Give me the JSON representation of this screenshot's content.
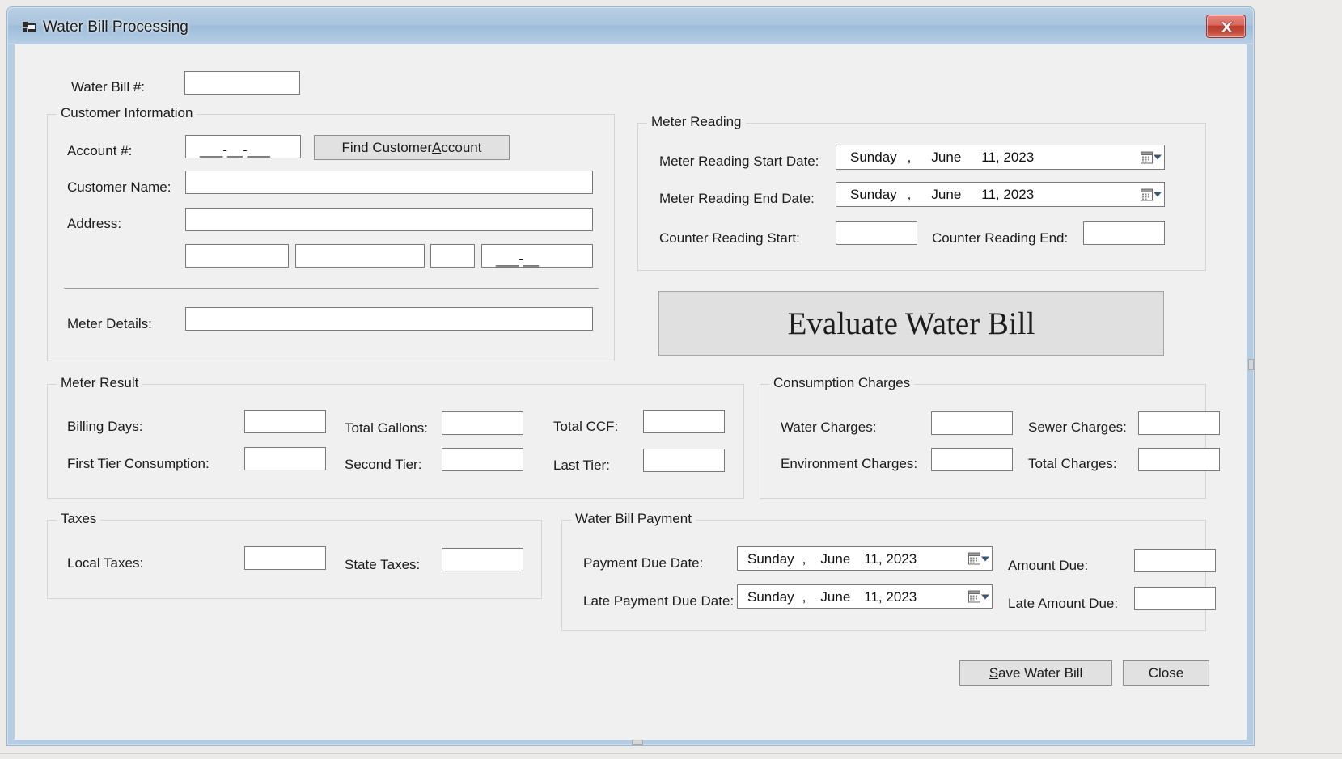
{
  "window": {
    "title": "Water Bill Processing",
    "icon": "application-form-icon",
    "close_label": "✕",
    "titlebar_color": "#a9c4dd",
    "close_color": "#ba3b2f",
    "form_background": "#f0f0f0"
  },
  "top": {
    "water_bill_label": "Water Bill #:",
    "water_bill_value": ""
  },
  "customer_information": {
    "title": "Customer Information",
    "account_label": "Account #:",
    "account_mask": "___-__-___",
    "find_button": {
      "prefix": "Find Customer ",
      "accel": "A",
      "suffix": "ccount",
      "full": "Find Customer Account"
    },
    "customer_name_label": "Customer Name:",
    "customer_name_value": "",
    "address_label": "Address:",
    "address_value": "",
    "city_value": "",
    "state_value": "",
    "zip_short_value": "",
    "zip_mask": "___-__",
    "meter_details_label": "Meter Details:",
    "meter_details_value": ""
  },
  "meter_reading": {
    "title": "Meter Reading",
    "start_date_label": "Meter Reading Start Date:",
    "start_date": {
      "day": "Sunday",
      "comma": ",",
      "month": "June",
      "date": "11, 2023"
    },
    "end_date_label": "Meter Reading End Date:",
    "end_date": {
      "day": "Sunday",
      "comma": ",",
      "month": "June",
      "date": "11, 2023"
    },
    "counter_start_label": "Counter Reading Start:",
    "counter_start_value": "",
    "counter_end_label": "Counter Reading End:",
    "counter_end_value": ""
  },
  "evaluate_button": {
    "label": "Evaluate Water Bill"
  },
  "meter_result": {
    "title": "Meter Result",
    "fields": [
      {
        "label": "Billing Days:",
        "value": ""
      },
      {
        "label": "Total Gallons:",
        "value": ""
      },
      {
        "label": "Total CCF:",
        "value": ""
      },
      {
        "label": "First Tier Consumption:",
        "value": ""
      },
      {
        "label": "Second Tier:",
        "value": ""
      },
      {
        "label": "Last Tier:",
        "value": ""
      }
    ]
  },
  "consumption_charges": {
    "title": "Consumption Charges",
    "fields": [
      {
        "label": "Water Charges:",
        "value": ""
      },
      {
        "label": "Sewer Charges:",
        "value": ""
      },
      {
        "label": "Environment Charges:",
        "value": ""
      },
      {
        "label": "Total Charges:",
        "value": ""
      }
    ]
  },
  "taxes": {
    "title": "Taxes",
    "fields": [
      {
        "label": "Local Taxes:",
        "value": ""
      },
      {
        "label": "State Taxes:",
        "value": ""
      }
    ]
  },
  "water_bill_payment": {
    "title": "Water Bill Payment",
    "payment_due_label": "Payment Due Date:",
    "payment_due_date": {
      "day": "Sunday",
      "comma": ",",
      "month": "June",
      "date": "11, 2023"
    },
    "amount_due_label": "Amount Due:",
    "amount_due_value": "",
    "late_due_label": "Late Payment Due Date:",
    "late_due_date": {
      "day": "Sunday",
      "comma": ",",
      "month": "June",
      "date": "11, 2023"
    },
    "late_amount_label": "Late Amount Due:",
    "late_amount_value": ""
  },
  "footer": {
    "save_button": {
      "accel": "S",
      "suffix": "ave Water Bill",
      "full": "Save Water Bill"
    },
    "close_button": {
      "label": "Close"
    }
  }
}
